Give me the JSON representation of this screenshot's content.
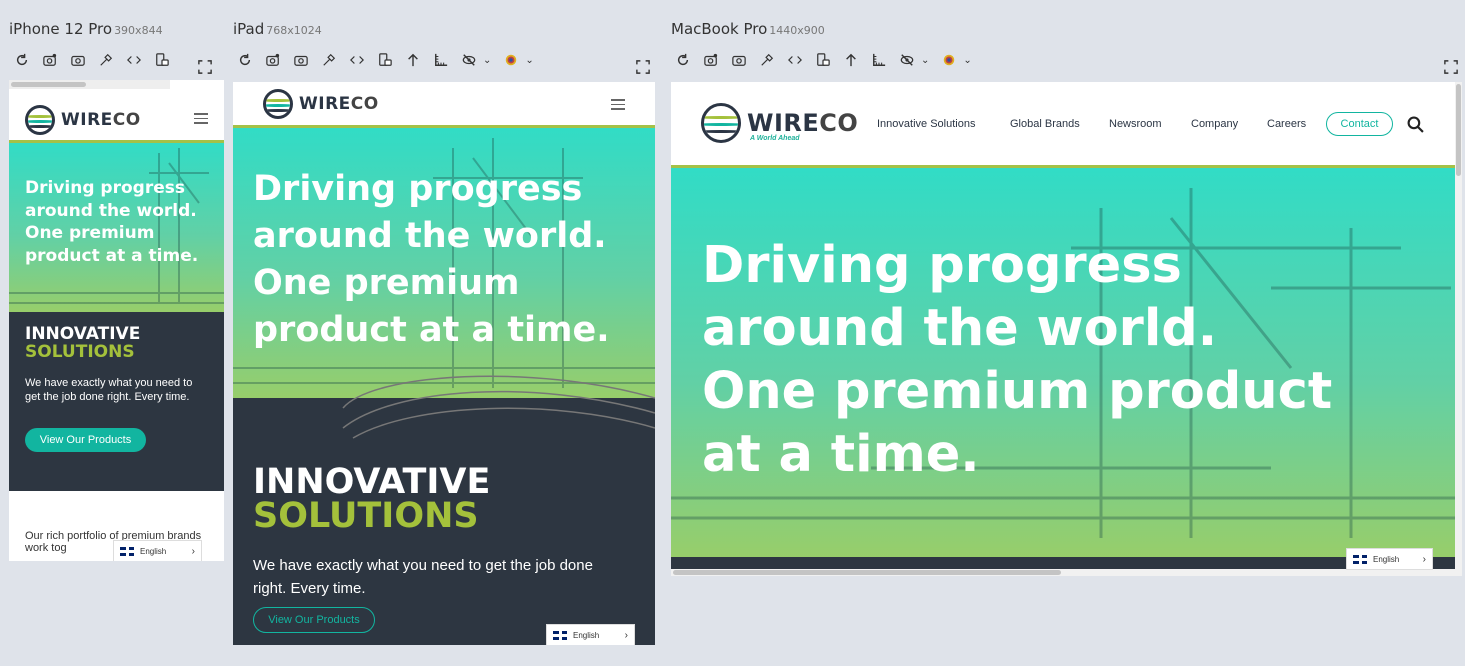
{
  "devices": {
    "iphone": {
      "name": "iPhone 12 Pro",
      "dims": "390x844"
    },
    "ipad": {
      "name": "iPad",
      "dims": "768x1024"
    },
    "macbook": {
      "name": "MacBook Pro",
      "dims": "1440x900"
    }
  },
  "icons": [
    "refresh-icon",
    "screenshot-settings-icon",
    "camera-icon",
    "eyedropper-icon",
    "code-icon",
    "device-rotate-icon",
    "upload-icon",
    "ruler-icon",
    "visibility-off-icon",
    "color-picker-icon",
    "fullscreen-icon"
  ],
  "site": {
    "logo_wire": "WIRE",
    "logo_co": "CO",
    "tagline": "A World Ahead",
    "nav": [
      "Innovative Solutions",
      "Global Brands",
      "Newsroom",
      "Company",
      "Careers"
    ],
    "contact": "Contact",
    "hero_mobile": "Driving progress around the world. One premium product at a time.",
    "innov_1": "INNOVATIVE",
    "innov_2": "SOLUTIONS",
    "innov_desc": "We have exactly what you need to get the job done right. Every time.",
    "cta": "View Our Products",
    "portfolio_text": "Our rich portfolio of premium brands work tog",
    "language": "English"
  },
  "colors": {
    "accent_teal": "#12b5a0",
    "accent_lime": "#a4c13b",
    "dark": "#2d3641",
    "page_bg": "#dfe3ea"
  }
}
